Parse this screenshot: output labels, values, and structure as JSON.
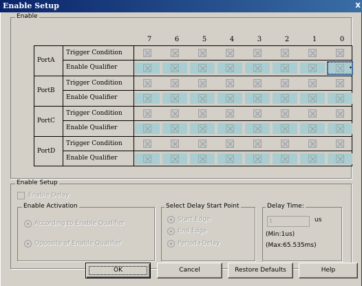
{
  "window": {
    "title": "Enable Setup",
    "close_label": "x"
  },
  "enable_group": {
    "label": "Enable",
    "columns": [
      "7",
      "6",
      "5",
      "4",
      "3",
      "2",
      "1",
      "0"
    ],
    "ports": [
      {
        "name": "PortA",
        "trigger_label": "Trigger Condition",
        "qualifier_label": "Enable Qualifier"
      },
      {
        "name": "PortB",
        "trigger_label": "Trigger Condition",
        "qualifier_label": "Enable Qualifier"
      },
      {
        "name": "PortC",
        "trigger_label": "Trigger Condition",
        "qualifier_label": "Enable Qualifier"
      },
      {
        "name": "PortD",
        "trigger_label": "Trigger Condition",
        "qualifier_label": "Enable Qualifier"
      }
    ],
    "dropdown_arrow": "▾"
  },
  "setup_group": {
    "label": "Enable Setup",
    "enable_delay_label": "Enable Delay",
    "activation": {
      "label": "Enable Activation",
      "option_1": "According to Enable Qualifier",
      "option_2": "Opposite of Enable Qualifier"
    },
    "delay_start": {
      "label": "Select Delay Start Point",
      "option_1": "Start Edge",
      "option_2": "End Edge",
      "option_3": "Period+Delay"
    },
    "delay_time": {
      "label": "Delay Time:",
      "value": "1",
      "unit": "us",
      "min": "(Min:1us)",
      "max": "(Max:65.535ms)"
    }
  },
  "buttons": {
    "ok": "OK",
    "cancel": "Cancel",
    "restore": "Restore Defaults",
    "help": "Help"
  },
  "colors": {
    "title_bar": "#0a246a",
    "qualifier_cell": "#a9cdd0",
    "dialog_bg": "#d4d0c8"
  }
}
